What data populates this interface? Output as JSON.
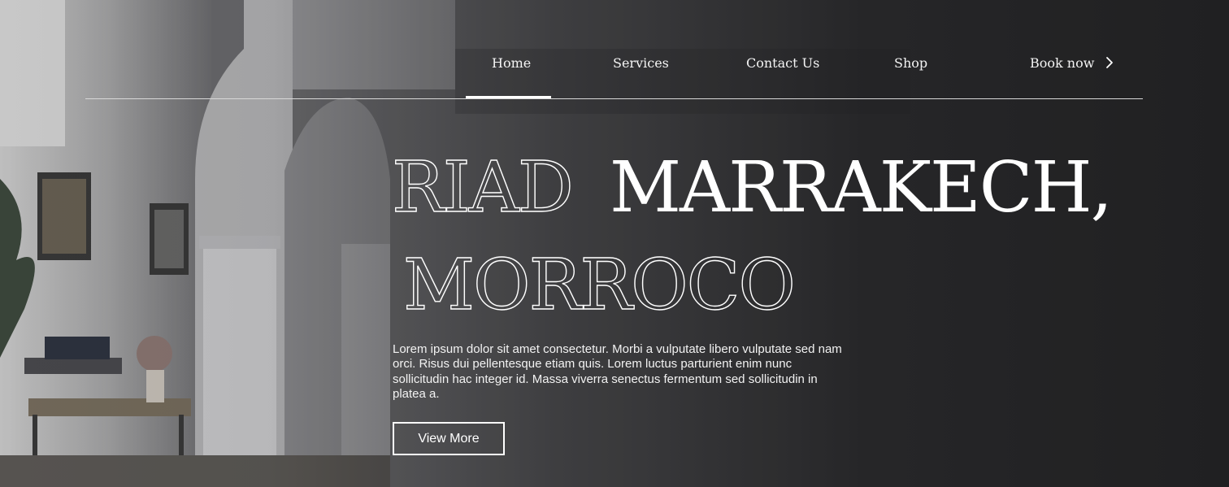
{
  "nav": {
    "items": [
      {
        "label": "Home",
        "active": true
      },
      {
        "label": "Services"
      },
      {
        "label": "Contact Us"
      },
      {
        "label": "Shop"
      }
    ],
    "book_label": "Book now",
    "book_icon": "chevron-right-icon"
  },
  "hero": {
    "title_outline_1": "RIAD",
    "title_solid": "MARRAKECH,",
    "title_outline_2": "MORROCO",
    "description": "Lorem ipsum dolor sit amet consectetur. Morbi a vulputate libero vulputate sed nam orci. Risus dui pellentesque etiam quis. Lorem luctus parturient enim nunc sollicitudin hac integer id. Massa viverra senectus fermentum sed sollicitudin in platea a.",
    "cta_label": "View More"
  },
  "colors": {
    "overlay": "#232325",
    "text": "#ffffff"
  }
}
